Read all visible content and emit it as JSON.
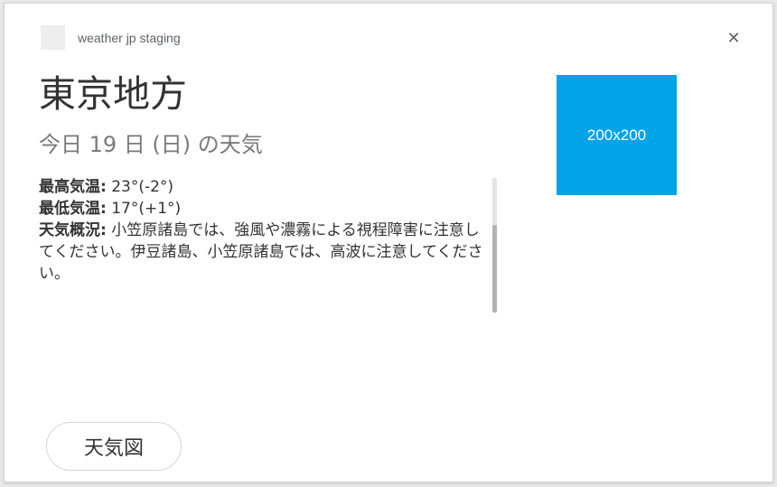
{
  "app": {
    "title": "weather jp staging",
    "icon_name": "app-icon",
    "close_icon": "close-icon"
  },
  "forecast": {
    "region": "東京地方",
    "date_line": "今日 19 日 (日) の天気",
    "max_temp_label": "最高気温:",
    "max_temp_value": " 23°(-2°)",
    "min_temp_label": "最低気温:",
    "min_temp_value": " 17°(+1°)",
    "summary_label": "天気概況:",
    "summary_value": " 小笠原諸島では、強風や濃霧による視程障害に注意してください。伊豆諸島、小笠原諸島では、高波に注意してください。"
  },
  "image": {
    "placeholder_text": "200x200",
    "color": "#03a3e8"
  },
  "actions": {
    "weather_map_button": "天気図"
  }
}
